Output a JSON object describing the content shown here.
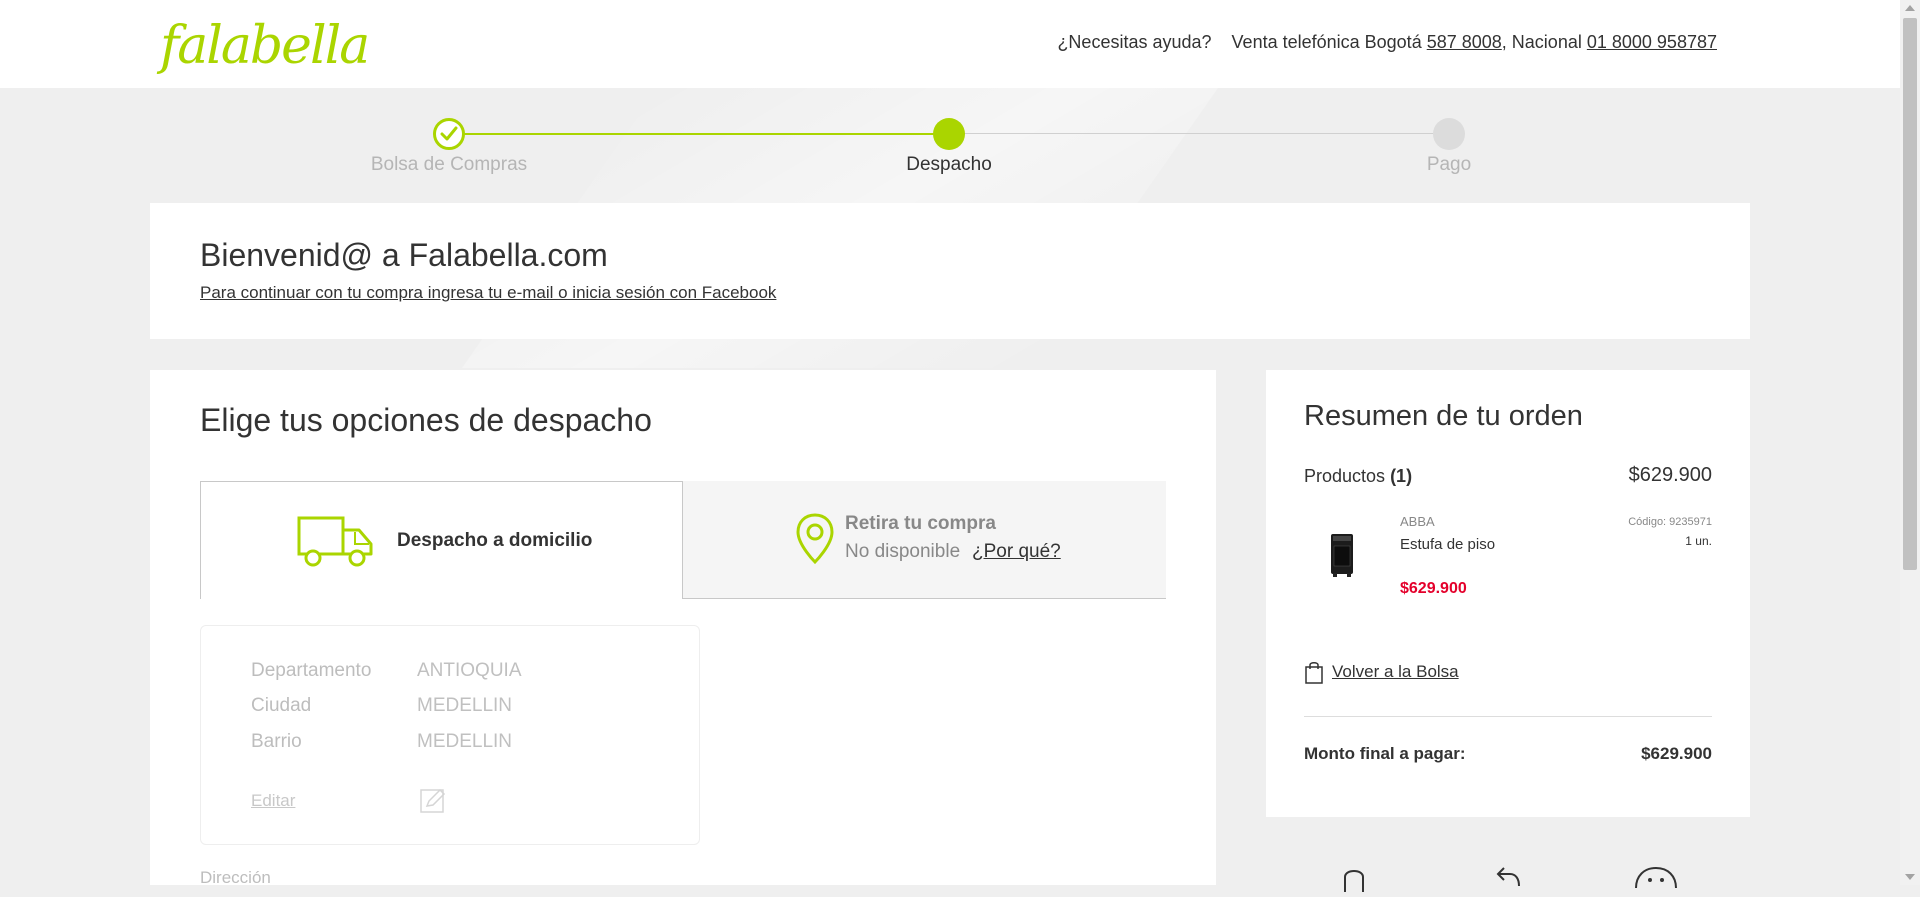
{
  "brand": {
    "logo": "falabella",
    "accent": "#aad500",
    "price_red": "#e4002b"
  },
  "header": {
    "help": "¿Necesitas ayuda?",
    "sales_label": "Venta telefónica Bogotá",
    "bogota_phone": "587 8008",
    "national_label": ", Nacional",
    "national_phone": "01 8000 958787"
  },
  "stepper": {
    "steps": [
      {
        "label": "Bolsa de Compras",
        "status": "done"
      },
      {
        "label": "Despacho",
        "status": "current"
      },
      {
        "label": "Pago",
        "status": "pending"
      }
    ]
  },
  "welcome": {
    "title": "Bienvenid@ a Falabella.com",
    "login_link": "Para continuar con tu compra ingresa tu e-mail o inicia sesión con Facebook"
  },
  "delivery": {
    "title": "Elige tus opciones de despacho",
    "tab_home": "Despacho a domicilio",
    "tab_store_title": "Retira tu compra",
    "tab_store_status": "No disponible",
    "tab_store_why": "¿Por qué?",
    "address": {
      "dept_label": "Departamento",
      "dept_value": "ANTIOQUIA",
      "city_label": "Ciudad",
      "city_value": "MEDELLIN",
      "barrio_label": "Barrio",
      "barrio_value": "MEDELLIN",
      "edit": "Editar"
    },
    "direccion_label": "Dirección"
  },
  "summary": {
    "title": "Resumen de tu orden",
    "products_label": "Productos",
    "products_count": "(1)",
    "products_total": "$629.900",
    "item": {
      "brand": "ABBA",
      "name": "Estufa de piso",
      "code": "Código: 9235971",
      "qty": "1 un.",
      "price": "$629.900"
    },
    "back_link": "Volver a la Bolsa",
    "final_label": "Monto final a pagar:",
    "final_value": "$629.900"
  },
  "icons": [
    "truck-icon",
    "location-pin-icon",
    "bag-icon",
    "edit-icon",
    "mouse-icon",
    "return-arrow-icon",
    "smiley-icon"
  ]
}
